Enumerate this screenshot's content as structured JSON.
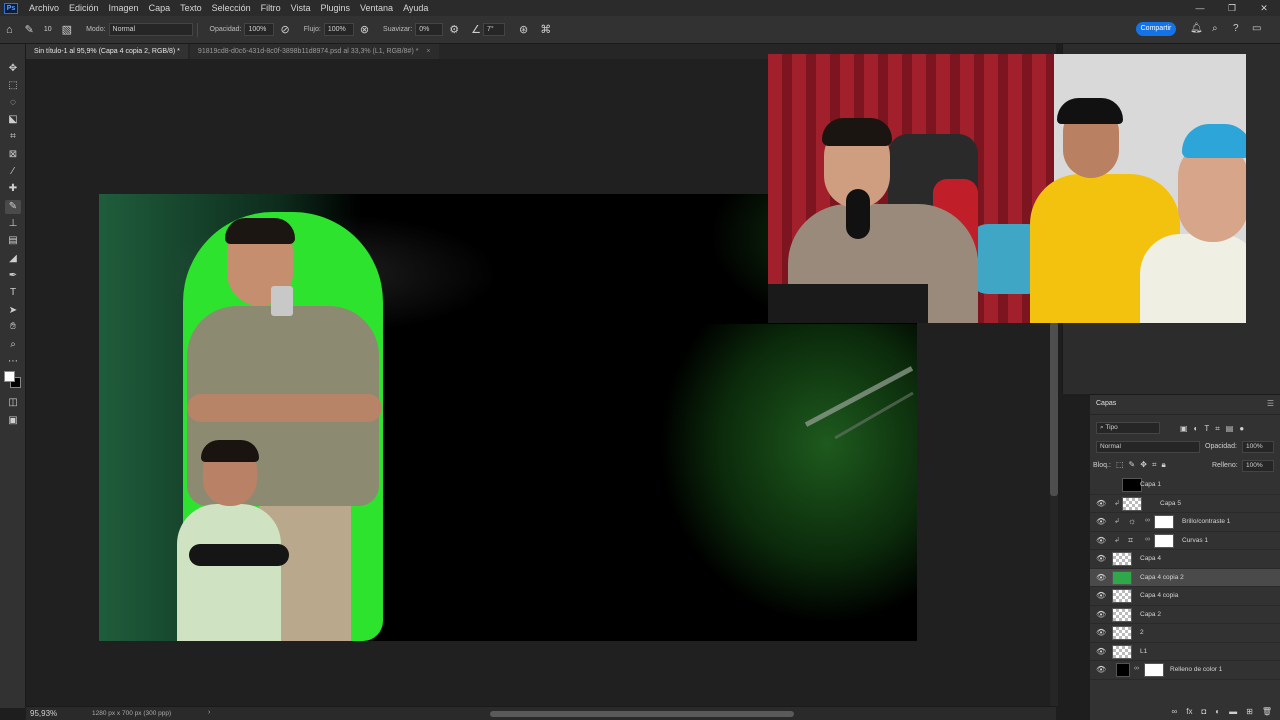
{
  "app": {
    "logo": "Ps"
  },
  "menu": [
    "Archivo",
    "Edición",
    "Imagen",
    "Capa",
    "Texto",
    "Selección",
    "Filtro",
    "Vista",
    "Plugins",
    "Ventana",
    "Ayuda"
  ],
  "window_controls": {
    "minimize": "—",
    "restore": "❐",
    "close": "✕"
  },
  "options": {
    "brush_size": "10",
    "mode_label": "Modo:",
    "mode_value": "Normal",
    "opacity_label": "Opacidad:",
    "opacity_value": "100%",
    "flow_label": "Flujo:",
    "flow_value": "100%",
    "smooth_label": "Suavizar:",
    "smooth_value": "0%",
    "angle_value": "7°",
    "share_label": "Compartir"
  },
  "tabs": [
    {
      "label": "Sin título-1 al 95,9% (Capa 4 copia 2, RGB/8) *",
      "close": "×"
    },
    {
      "label": "91819cd8-d0c6-431d-8c0f-3898b11d8974.psd al 33,3% (L1, RGB/8#) *",
      "close": "×"
    }
  ],
  "layers_panel": {
    "title": "Capas",
    "search_placeholder": "Tipo",
    "blend_mode": "Normal",
    "opacity_label": "Opacidad:",
    "opacity_value": "100%",
    "lock_label": "Bloq.:",
    "fill_label": "Relleno:",
    "fill_value": "100%",
    "layers": [
      {
        "name": "Capa 1",
        "visible": false,
        "selected": false
      },
      {
        "name": "Capa 5",
        "visible": true,
        "selected": false
      },
      {
        "name": "Brillo/contraste 1",
        "visible": true,
        "selected": false
      },
      {
        "name": "Curvas 1",
        "visible": true,
        "selected": false
      },
      {
        "name": "Capa 4",
        "visible": true,
        "selected": false
      },
      {
        "name": "Capa 4 copia 2",
        "visible": true,
        "selected": true
      },
      {
        "name": "Capa 4 copia",
        "visible": true,
        "selected": false
      },
      {
        "name": "Capa 2",
        "visible": true,
        "selected": false
      },
      {
        "name": "2",
        "visible": true,
        "selected": false
      },
      {
        "name": "L1",
        "visible": true,
        "selected": false
      },
      {
        "name": "Relleno de color 1",
        "visible": true,
        "selected": false
      }
    ]
  },
  "status": {
    "zoom": "95,93%",
    "doc_info": "1280 px x 700 px (300 ppp)",
    "arrow": "›"
  },
  "colors": {
    "accent": "#1473e6",
    "panel": "#323232",
    "canvas_glow": "#2de32d"
  }
}
